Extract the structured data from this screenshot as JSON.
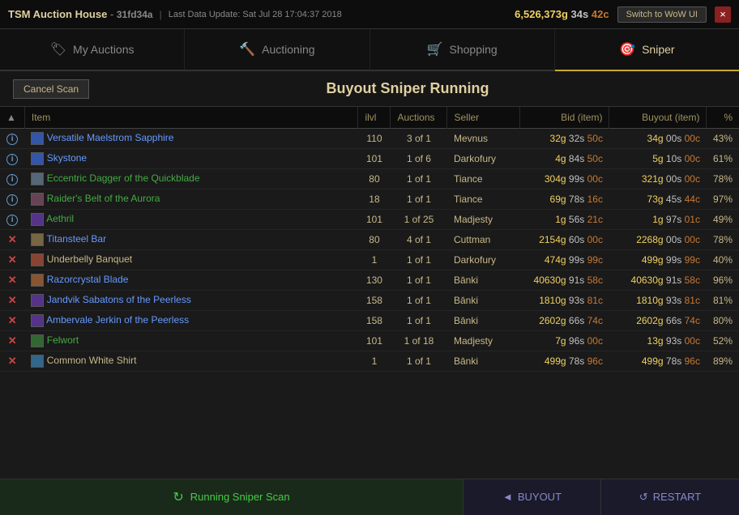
{
  "titleBar": {
    "appName": "TSM Auction House",
    "instanceId": "31fd34a",
    "lastUpdate": "Last Data Update: Sat Jul 28 17:04:37 2018",
    "gold": "6,526,373",
    "goldUnit": "g",
    "silver": "34",
    "silverUnit": "s",
    "copper": "42",
    "copperUnit": "c",
    "switchBtn": "Switch to WoW UI",
    "closeBtn": "×"
  },
  "nav": {
    "tabs": [
      {
        "id": "my-auctions",
        "label": "My Auctions",
        "icon": "🏷",
        "active": false
      },
      {
        "id": "auctioning",
        "label": "Auctioning",
        "icon": "🔨",
        "active": false
      },
      {
        "id": "shopping",
        "label": "Shopping",
        "icon": "🛒",
        "active": false
      },
      {
        "id": "sniper",
        "label": "Sniper",
        "icon": "🎯",
        "active": true
      }
    ]
  },
  "actionBar": {
    "cancelScan": "Cancel Scan",
    "pageTitle": "Buyout Sniper Running"
  },
  "table": {
    "headers": [
      {
        "id": "sort",
        "label": "▲",
        "align": "center"
      },
      {
        "id": "item",
        "label": "Item",
        "align": "left"
      },
      {
        "id": "ilvl",
        "label": "ilvl",
        "align": "center"
      },
      {
        "id": "auctions",
        "label": "Auctions",
        "align": "center"
      },
      {
        "id": "seller",
        "label": "Seller",
        "align": "left"
      },
      {
        "id": "bid",
        "label": "Bid (item)",
        "align": "right"
      },
      {
        "id": "buyout",
        "label": "Buyout (item)",
        "align": "right"
      },
      {
        "id": "pct",
        "label": "%",
        "align": "right"
      }
    ],
    "rows": [
      {
        "status": "i",
        "statusType": "info",
        "iconType": "gem",
        "item": "Versatile Maelstrom Sapphire",
        "itemColor": "blue",
        "ilvl": "110",
        "auctions": "3 of 1",
        "seller": "Mevnus",
        "bid": "32g 32s 50c",
        "buyout": "34g 00s 00c",
        "pct": "43%",
        "pctType": "yellow"
      },
      {
        "status": "i",
        "statusType": "info",
        "iconType": "gem",
        "item": "Skystone",
        "itemColor": "blue",
        "ilvl": "101",
        "auctions": "1 of 6",
        "seller": "Darkofury",
        "bid": "4g 84s 50c",
        "buyout": "5g 10s 00c",
        "pct": "61%",
        "pctType": "orange"
      },
      {
        "status": "i",
        "statusType": "info",
        "iconType": "dagger",
        "item": "Eccentric Dagger of the Quickblade",
        "itemColor": "green",
        "ilvl": "80",
        "auctions": "1 of 1",
        "seller": "Tiance",
        "bid": "304g 99s 00c",
        "buyout": "321g 00s 00c",
        "pct": "78%",
        "pctType": "orange"
      },
      {
        "status": "i",
        "statusType": "info",
        "iconType": "belt",
        "item": "Raider's Belt of the Aurora",
        "itemColor": "green",
        "ilvl": "18",
        "auctions": "1 of 1",
        "seller": "Tiance",
        "bid": "69g 78s 16c",
        "buyout": "73g 45s 44c",
        "pct": "97%",
        "pctType": "red"
      },
      {
        "status": "i",
        "statusType": "info",
        "iconType": "armor",
        "item": "Aethril",
        "itemColor": "green",
        "ilvl": "101",
        "auctions": "1 of 25",
        "seller": "Madjesty",
        "bid": "1g 56s 21c",
        "buyout": "1g 97s 01c",
        "pct": "49%",
        "pctType": "yellow"
      },
      {
        "status": "x",
        "statusType": "x",
        "iconType": "bar",
        "item": "Titansteel Bar",
        "itemColor": "blue",
        "ilvl": "80",
        "auctions": "4 of 1",
        "seller": "Cuttman",
        "bid": "2154g 60s 00c",
        "buyout": "2268g 00s 00c",
        "pct": "78%",
        "pctType": "orange"
      },
      {
        "status": "x",
        "statusType": "x",
        "iconType": "food",
        "item": "Underbelly Banquet",
        "itemColor": "white",
        "ilvl": "1",
        "auctions": "1 of 1",
        "seller": "Darkofury",
        "bid": "474g 99s 99c",
        "buyout": "499g 99s 99c",
        "pct": "40%",
        "pctType": "yellow"
      },
      {
        "status": "x",
        "statusType": "x",
        "iconType": "weapon",
        "item": "Razorcrystal Blade",
        "itemColor": "blue",
        "ilvl": "130",
        "auctions": "1 of 1",
        "seller": "Bānki",
        "bid": "40630g 91s 58c",
        "buyout": "40630g 91s 58c",
        "pct": "96%",
        "pctType": "red"
      },
      {
        "status": "x",
        "statusType": "x",
        "iconType": "armor",
        "item": "Jandvik Sabatons of the Peerless",
        "itemColor": "blue",
        "ilvl": "158",
        "auctions": "1 of 1",
        "seller": "Bānki",
        "bid": "1810g 93s 81c",
        "buyout": "1810g 93s 81c",
        "pct": "81%",
        "pctType": "orange"
      },
      {
        "status": "x",
        "statusType": "x",
        "iconType": "armor",
        "item": "Ambervale Jerkin of the Peerless",
        "itemColor": "blue",
        "ilvl": "158",
        "auctions": "1 of 1",
        "seller": "Bānki",
        "bid": "2602g 66s 74c",
        "buyout": "2602g 66s 74c",
        "pct": "80%",
        "pctType": "orange"
      },
      {
        "status": "x",
        "statusType": "x",
        "iconType": "herb",
        "item": "Felwort",
        "itemColor": "green",
        "ilvl": "101",
        "auctions": "1 of 18",
        "seller": "Madjesty",
        "bid": "7g 96s 00c",
        "buyout": "13g 93s 00c",
        "pct": "52%",
        "pctType": "yellow"
      },
      {
        "status": "x",
        "statusType": "x",
        "iconType": "shirt",
        "item": "Common White Shirt",
        "itemColor": "white",
        "ilvl": "1",
        "auctions": "1 of 1",
        "seller": "Bānki",
        "bid": "499g 78s 96c",
        "buyout": "499g 78s 96c",
        "pct": "89%",
        "pctType": "red"
      }
    ]
  },
  "footer": {
    "runningScan": "Running Sniper Scan",
    "buyout": "BUYOUT",
    "restart": "RESTART"
  }
}
